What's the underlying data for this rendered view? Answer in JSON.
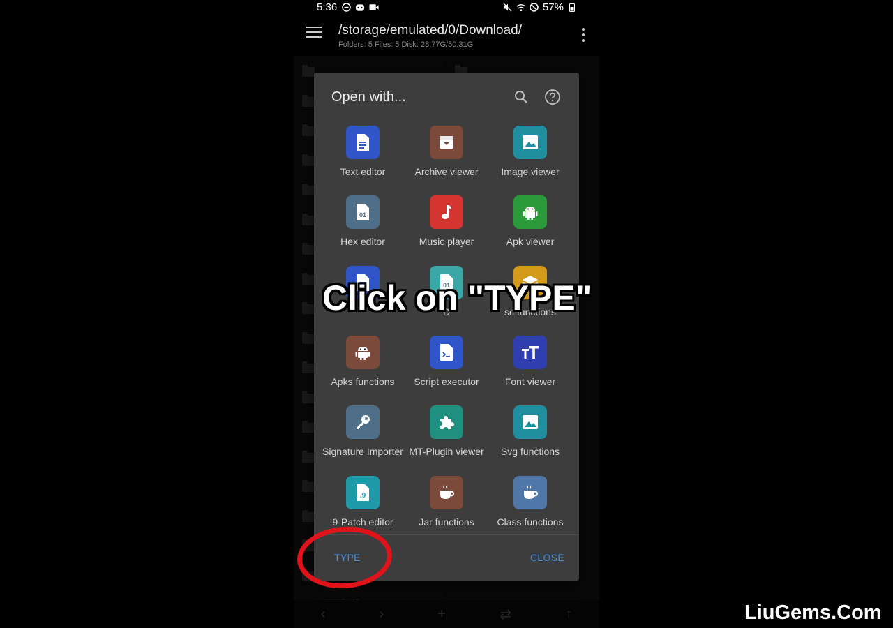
{
  "status_bar": {
    "time": "5:36",
    "battery": "57%"
  },
  "app_bar": {
    "path": "/storage/emulated/0/Download/",
    "info": "Folders: 5  Files: 5  Disk: 28.77G/50.31G"
  },
  "background": {
    "partial_file_name": "overshoot"
  },
  "dialog": {
    "title": "Open with...",
    "apps": [
      {
        "label": "Text editor",
        "icon": "text-editor-icon",
        "color": "#2f55c8"
      },
      {
        "label": "Archive viewer",
        "icon": "archive-icon",
        "color": "#7b4a3a"
      },
      {
        "label": "Image viewer",
        "icon": "image-icon",
        "color": "#1f8fa0"
      },
      {
        "label": "Hex editor",
        "icon": "hex-icon",
        "color": "#4f6f88"
      },
      {
        "label": "Music player",
        "icon": "music-icon",
        "color": "#d43530"
      },
      {
        "label": "Apk viewer",
        "icon": "android-icon",
        "color": "#2a9a3a"
      },
      {
        "label": "",
        "icon": "document-icon",
        "color": "#2f55c8"
      },
      {
        "label": "D",
        "icon": "hex-icon",
        "color": "#3aa6a6"
      },
      {
        "label": "sc functions",
        "icon": "layers-icon",
        "color": "#d49a1a"
      },
      {
        "label": "Apks functions",
        "icon": "android-icon",
        "color": "#7b4a3a"
      },
      {
        "label": "Script executor",
        "icon": "script-icon",
        "color": "#2f55c8"
      },
      {
        "label": "Font viewer",
        "icon": "font-icon",
        "color": "#2f3fb0"
      },
      {
        "label": "Signature Importer",
        "icon": "key-icon",
        "color": "#4f6f88"
      },
      {
        "label": "MT-Plugin viewer",
        "icon": "puzzle-icon",
        "color": "#1f8f80"
      },
      {
        "label": "Svg functions",
        "icon": "image-icon",
        "color": "#1f8fa0"
      },
      {
        "label": "9-Patch editor",
        "icon": "nine-patch-icon",
        "color": "#1f9aa8"
      },
      {
        "label": "Jar functions",
        "icon": "cup-icon",
        "color": "#7b4a3a"
      },
      {
        "label": "Class functions",
        "icon": "cup-icon",
        "color": "#4f78a8"
      }
    ],
    "type_button": "TYPE",
    "close_button": "CLOSE"
  },
  "caption": "Click on \"TYPE\"",
  "watermark": "LiuGems.Com"
}
